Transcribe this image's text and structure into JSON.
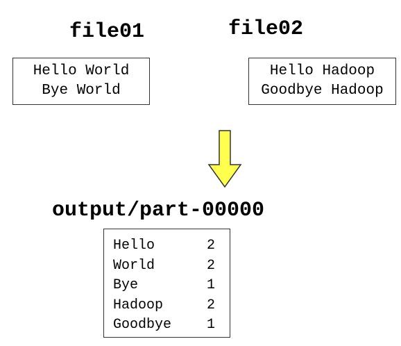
{
  "inputs": [
    {
      "name": "file01",
      "lines": [
        "Hello World",
        "Bye World"
      ]
    },
    {
      "name": "file02",
      "lines": [
        "Hello Hadoop",
        "Goodbye Hadoop"
      ]
    }
  ],
  "output": {
    "name": "output/part-00000",
    "rows": [
      {
        "word": "Hello",
        "count": "2"
      },
      {
        "word": "World",
        "count": "2"
      },
      {
        "word": "Bye",
        "count": "1"
      },
      {
        "word": "Hadoop",
        "count": "2"
      },
      {
        "word": "Goodbye",
        "count": "1"
      }
    ]
  },
  "colors": {
    "arrow_fill": "#ffff4d",
    "arrow_stroke": "#333333",
    "border": "#333333"
  }
}
